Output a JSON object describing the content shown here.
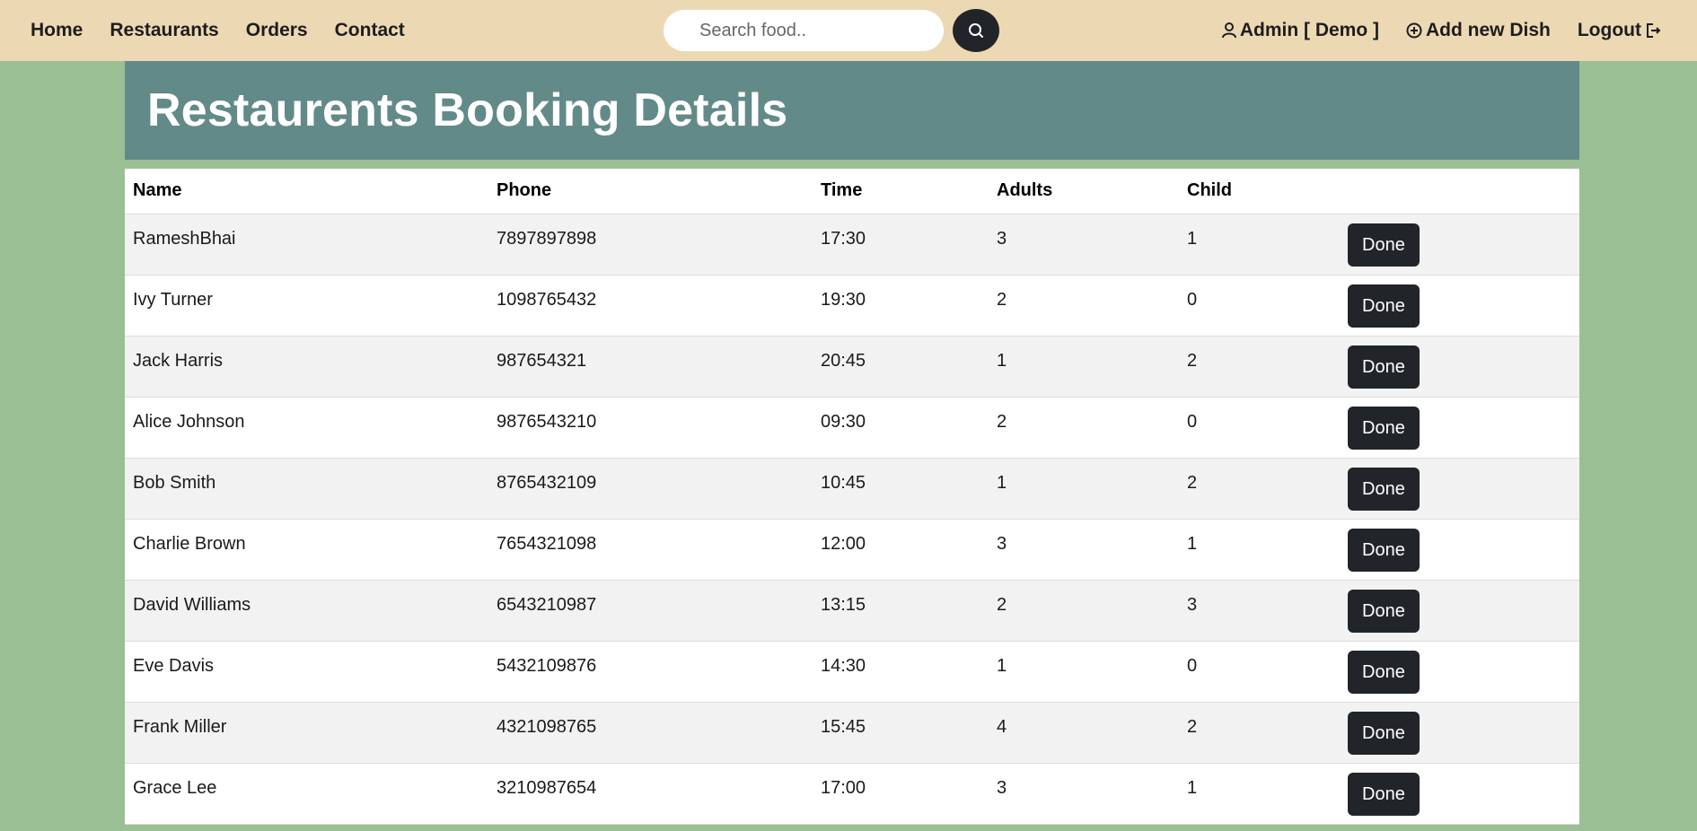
{
  "nav": {
    "links": [
      "Home",
      "Restaurants",
      "Orders",
      "Contact"
    ],
    "search_placeholder": "Search food..",
    "admin_label": "Admin [ Demo ]",
    "add_dish_label": "Add new Dish",
    "logout_label": "Logout"
  },
  "banner": {
    "title": "Restaurents Booking Details"
  },
  "table": {
    "headers": [
      "Name",
      "Phone",
      "Time",
      "Adults",
      "Child",
      ""
    ],
    "action_label": "Done",
    "rows": [
      [
        "RameshBhai",
        "7897897898",
        "17:30",
        "3",
        "1"
      ],
      [
        "Ivy Turner",
        "1098765432",
        "19:30",
        "2",
        "0"
      ],
      [
        "Jack Harris",
        "987654321",
        "20:45",
        "1",
        "2"
      ],
      [
        "Alice Johnson",
        "9876543210",
        "09:30",
        "2",
        "0"
      ],
      [
        "Bob Smith",
        "8765432109",
        "10:45",
        "1",
        "2"
      ],
      [
        "Charlie Brown",
        "7654321098",
        "12:00",
        "3",
        "1"
      ],
      [
        "David Williams",
        "6543210987",
        "13:15",
        "2",
        "3"
      ],
      [
        "Eve Davis",
        "5432109876",
        "14:30",
        "1",
        "0"
      ],
      [
        "Frank Miller",
        "4321098765",
        "15:45",
        "4",
        "2"
      ],
      [
        "Grace Lee",
        "3210987654",
        "17:00",
        "3",
        "1"
      ]
    ]
  },
  "colors": {
    "navbar_bg": "#ecd9b3",
    "page_bg": "#9bbf94",
    "banner_bg": "#628a89",
    "button_bg": "#212529"
  },
  "icons": {
    "search": "search-icon",
    "admin": "user-icon",
    "add": "plus-circle-icon",
    "logout": "logout-icon"
  }
}
